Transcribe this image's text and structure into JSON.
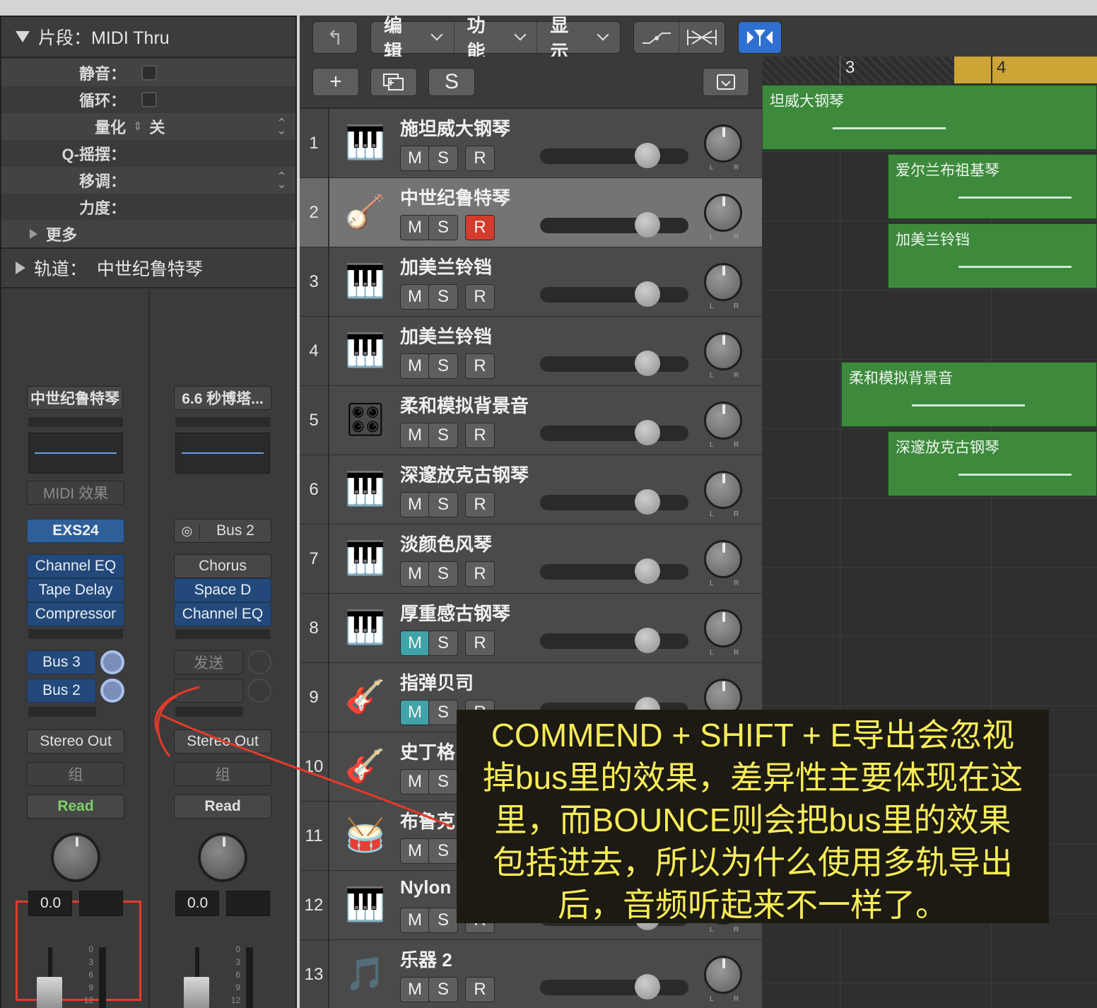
{
  "inspector": {
    "region_header": "片段：MIDI Thru",
    "props": [
      {
        "label": "静音：",
        "type": "checkbox"
      },
      {
        "label": "循环：",
        "type": "checkbox"
      },
      {
        "label": "量化",
        "value": "关",
        "type": "select"
      },
      {
        "label": "Q-摇摆：",
        "type": "value"
      },
      {
        "label": "移调：",
        "type": "select"
      },
      {
        "label": "力度：",
        "type": "value"
      }
    ],
    "more_label": "更多",
    "track_header": "轨道：  中世纪鲁特琴"
  },
  "strips": {
    "left": {
      "name": "中世纪鲁特琴",
      "midi_fx": "MIDI 效果",
      "instrument": "EXS24",
      "effects": [
        "Channel EQ",
        "Tape Delay",
        "Compressor"
      ],
      "sends": [
        "Bus 3",
        "Bus 2"
      ],
      "output": "Stereo Out",
      "group": "组",
      "automation": "Read",
      "volume": "0.0",
      "scale": [
        "0",
        "3",
        "6",
        "9",
        "12"
      ]
    },
    "right": {
      "name": "6.6 秒博塔...",
      "input": "Bus 2",
      "effects": [
        "Chorus",
        "Space D",
        "Channel EQ"
      ],
      "send_placeholder": "发送",
      "output": "Stereo Out",
      "group": "组",
      "automation": "Read",
      "volume": "0.0",
      "scale": [
        "0",
        "3",
        "6",
        "9",
        "12"
      ]
    }
  },
  "toolbar": {
    "menus": [
      "编辑",
      "功能",
      "显示"
    ],
    "add_label": "+",
    "s_label": "S"
  },
  "ruler": {
    "bar3": "3",
    "bar4": "4"
  },
  "buttons": {
    "mute": "M",
    "solo": "S",
    "record": "R",
    "pan_l": "L",
    "pan_r": "R"
  },
  "tracks": [
    {
      "num": "1",
      "name": "施坦威大钢琴",
      "icon": "grand-piano-icon",
      "glyph": "🎹"
    },
    {
      "num": "2",
      "name": "中世纪鲁特琴",
      "icon": "lute-icon",
      "glyph": "🪕",
      "selected": true,
      "record": true
    },
    {
      "num": "3",
      "name": "加美兰铃铛",
      "icon": "keyboard-stand-icon",
      "glyph": "🎹"
    },
    {
      "num": "4",
      "name": "加美兰铃铛",
      "icon": "keyboard-stand-icon",
      "glyph": "🎹"
    },
    {
      "num": "5",
      "name": "柔和模拟背景音",
      "icon": "synth-icon",
      "glyph": "🎛"
    },
    {
      "num": "6",
      "name": "深邃放克古钢琴",
      "icon": "clavinet-icon",
      "glyph": "🎹"
    },
    {
      "num": "7",
      "name": "淡颜色风琴",
      "icon": "organ-icon",
      "glyph": "🎹"
    },
    {
      "num": "8",
      "name": "厚重感古钢琴",
      "icon": "clavinet-icon",
      "glyph": "🎹",
      "mute": true
    },
    {
      "num": "9",
      "name": "指弹贝司",
      "icon": "bass-guitar-icon",
      "glyph": "🎸",
      "mute": true
    },
    {
      "num": "10",
      "name": "史丁格",
      "icon": "bass-guitar-icon",
      "glyph": "🎸"
    },
    {
      "num": "11",
      "name": "布鲁克",
      "icon": "drum-kit-icon",
      "glyph": "🥁"
    },
    {
      "num": "12",
      "name": "Nylon",
      "icon": "keyboard-stand-icon",
      "glyph": "🎹"
    },
    {
      "num": "13",
      "name": "乐器 2",
      "icon": "music-note-icon",
      "glyph": "🎵"
    }
  ],
  "regions": [
    {
      "label": "坦威大钢琴",
      "track": 1
    },
    {
      "label": "爱尔兰布祖基琴",
      "track": 2
    },
    {
      "label": "加美兰铃铛",
      "track": 3
    },
    {
      "label": "柔和模拟背景音",
      "track": 5
    },
    {
      "label": "深邃放克古钢琴",
      "track": 6
    }
  ],
  "annotation": {
    "lines": [
      "COMMEND + SHIFT + E导出会忽视",
      "掉bus里的效果，差异性主要体现在这",
      "里，而BOUNCE则会把bus里的效果",
      "包括进去，所以为什么使用多轨导出",
      "后，音频听起来不一样了。"
    ],
    "color": "#f7ec5a",
    "highlight_color": "#e53a2b"
  }
}
